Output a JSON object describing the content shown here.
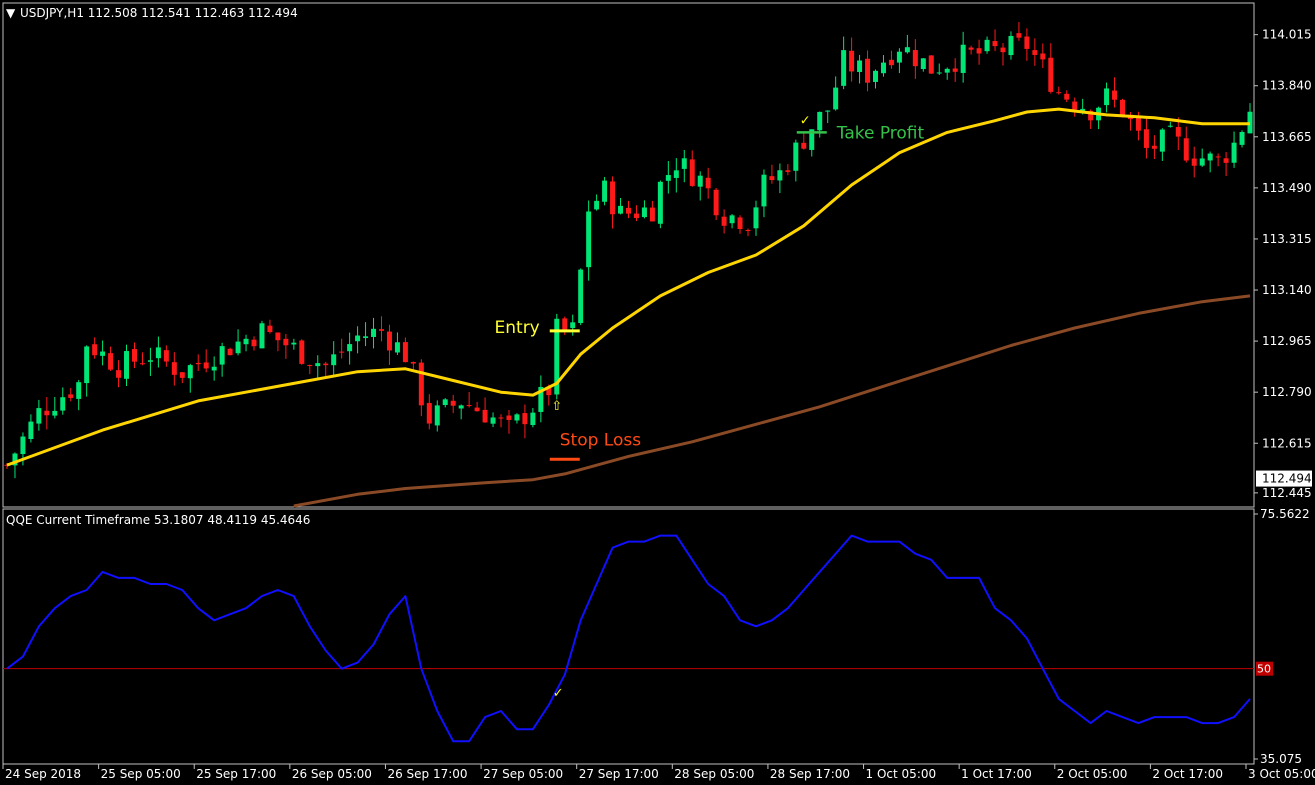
{
  "header": {
    "symbol_line": "USDJPY,H1  112.508 112.541 112.463 112.494",
    "indicator_line": "QQE Current Timeframe 53.1807 48.4119 45.4646"
  },
  "colors": {
    "background": "#000000",
    "frame": "#c0c0c0",
    "bull_candle": "#00e676",
    "bear_candle": "#ff1a1a",
    "ma_fast": "#ffd500",
    "ma_slow": "#8b4a26",
    "qqe_line": "#1010ff",
    "level_line": "#c00000",
    "entry": "#ffff33",
    "stop_loss": "#ff4a14",
    "take_profit": "#36c24a",
    "check": "#ffff00"
  },
  "chart_data": [
    {
      "type": "candlestick",
      "symbol": "USDJPY",
      "timeframe": "H1",
      "ylim": [
        112.4,
        114.12
      ],
      "y_ticks": [
        "114.015",
        "113.840",
        "113.665",
        "113.490",
        "113.315",
        "113.140",
        "112.965",
        "112.790",
        "112.615",
        "112.445"
      ],
      "y_tick_values": [
        114.015,
        113.84,
        113.665,
        113.49,
        113.315,
        113.14,
        112.965,
        112.79,
        112.615,
        112.445
      ],
      "current_price": "112.494",
      "current_price_value": 112.494,
      "ohlc_header": {
        "open": 112.508,
        "high": 112.541,
        "low": 112.463,
        "close": 112.494
      },
      "x_ticks": [
        "24 Sep 2018",
        "25 Sep 05:00",
        "25 Sep 17:00",
        "26 Sep 05:00",
        "26 Sep 17:00",
        "27 Sep 05:00",
        "27 Sep 17:00",
        "28 Sep 05:00",
        "28 Sep 17:00",
        "1 Oct 05:00",
        "1 Oct 17:00",
        "2 Oct 05:00",
        "2 Oct 17:00",
        "3 Oct 05:00"
      ],
      "x_tick_index": [
        0,
        12,
        24,
        36,
        48,
        60,
        72,
        84,
        96,
        108,
        120,
        132,
        144,
        156
      ],
      "bar_count": 157,
      "close_path": [
        [
          0,
          112.54
        ],
        [
          4,
          112.72
        ],
        [
          9,
          112.82
        ],
        [
          10,
          112.96
        ],
        [
          14,
          112.88
        ],
        [
          18,
          112.92
        ],
        [
          22,
          112.86
        ],
        [
          26,
          112.92
        ],
        [
          32,
          113.0
        ],
        [
          36,
          112.94
        ],
        [
          40,
          112.88
        ],
        [
          44,
          112.98
        ],
        [
          47,
          113.0
        ],
        [
          50,
          112.92
        ],
        [
          53,
          112.7
        ],
        [
          57,
          112.76
        ],
        [
          60,
          112.72
        ],
        [
          63,
          112.66
        ],
        [
          66,
          112.74
        ],
        [
          68,
          112.8
        ],
        [
          69,
          113.0
        ],
        [
          71,
          113.0
        ],
        [
          72,
          113.2
        ],
        [
          73,
          113.42
        ],
        [
          75,
          113.48
        ],
        [
          77,
          113.4
        ],
        [
          81,
          113.42
        ],
        [
          82,
          113.5
        ],
        [
          84,
          113.58
        ],
        [
          87,
          113.52
        ],
        [
          90,
          113.4
        ],
        [
          93,
          113.38
        ],
        [
          95,
          113.5
        ],
        [
          97,
          113.54
        ],
        [
          99,
          113.62
        ],
        [
          101,
          113.7
        ],
        [
          103,
          113.76
        ],
        [
          105,
          113.92
        ],
        [
          108,
          113.88
        ],
        [
          112,
          113.98
        ],
        [
          116,
          113.9
        ],
        [
          120,
          113.94
        ],
        [
          124,
          113.96
        ],
        [
          128,
          113.98
        ],
        [
          132,
          113.82
        ],
        [
          136,
          113.76
        ],
        [
          138,
          113.8
        ],
        [
          140,
          113.76
        ],
        [
          143,
          113.62
        ],
        [
          146,
          113.66
        ],
        [
          149,
          113.6
        ],
        [
          152,
          113.58
        ],
        [
          154,
          113.64
        ],
        [
          156,
          113.76
        ]
      ],
      "ma_fast": [
        [
          0,
          112.54
        ],
        [
          12,
          112.66
        ],
        [
          24,
          112.76
        ],
        [
          36,
          112.82
        ],
        [
          44,
          112.86
        ],
        [
          50,
          112.87
        ],
        [
          56,
          112.83
        ],
        [
          62,
          112.79
        ],
        [
          66,
          112.78
        ],
        [
          69,
          112.82
        ],
        [
          72,
          112.92
        ],
        [
          76,
          113.01
        ],
        [
          82,
          113.12
        ],
        [
          88,
          113.2
        ],
        [
          94,
          113.26
        ],
        [
          100,
          113.36
        ],
        [
          106,
          113.5
        ],
        [
          112,
          113.61
        ],
        [
          118,
          113.68
        ],
        [
          124,
          113.72
        ],
        [
          128,
          113.75
        ],
        [
          132,
          113.76
        ],
        [
          138,
          113.74
        ],
        [
          144,
          113.73
        ],
        [
          150,
          113.71
        ],
        [
          156,
          113.71
        ]
      ],
      "ma_slow": [
        [
          36,
          112.4
        ],
        [
          44,
          112.44
        ],
        [
          50,
          112.46
        ],
        [
          60,
          112.48
        ],
        [
          66,
          112.49
        ],
        [
          70,
          112.51
        ],
        [
          78,
          112.57
        ],
        [
          86,
          112.62
        ],
        [
          94,
          112.68
        ],
        [
          102,
          112.74
        ],
        [
          110,
          112.81
        ],
        [
          118,
          112.88
        ],
        [
          126,
          112.95
        ],
        [
          134,
          113.01
        ],
        [
          142,
          113.06
        ],
        [
          150,
          113.1
        ],
        [
          156,
          113.12
        ]
      ],
      "annotations": [
        {
          "label": "Entry",
          "price": 113.0,
          "bar": 70
        },
        {
          "label": "Stop Loss",
          "price": 112.56,
          "bar": 70
        },
        {
          "label": "Take Profit",
          "price": 113.68,
          "bar": 101
        }
      ],
      "signal_arrow": {
        "bar": 69,
        "price": 112.75
      }
    },
    {
      "type": "line",
      "name": "QQE Current Timeframe",
      "values_header": [
        53.1807,
        48.4119,
        45.4646
      ],
      "ylim": [
        35.075,
        75.5622
      ],
      "y_ticks": [
        "75.5622",
        "35.075"
      ],
      "y_tick_values": [
        75.5622,
        35.075
      ],
      "level": 50,
      "level_label": "50",
      "series": [
        {
          "values": [
            [
              0,
              50
            ],
            [
              2,
              52
            ],
            [
              4,
              57
            ],
            [
              6,
              60
            ],
            [
              8,
              62
            ],
            [
              10,
              63
            ],
            [
              12,
              66
            ],
            [
              14,
              65
            ],
            [
              16,
              65
            ],
            [
              18,
              64
            ],
            [
              20,
              64
            ],
            [
              22,
              63
            ],
            [
              24,
              60
            ],
            [
              26,
              58
            ],
            [
              28,
              59
            ],
            [
              30,
              60
            ],
            [
              32,
              62
            ],
            [
              34,
              63
            ],
            [
              36,
              62
            ],
            [
              38,
              57
            ],
            [
              40,
              53
            ],
            [
              42,
              50
            ],
            [
              44,
              51
            ],
            [
              46,
              54
            ],
            [
              48,
              59
            ],
            [
              50,
              62
            ],
            [
              52,
              50
            ],
            [
              54,
              43
            ],
            [
              56,
              38
            ],
            [
              58,
              38
            ],
            [
              60,
              42
            ],
            [
              62,
              43
            ],
            [
              64,
              40
            ],
            [
              66,
              40
            ],
            [
              68,
              44
            ],
            [
              70,
              49
            ],
            [
              72,
              58
            ],
            [
              74,
              64
            ],
            [
              76,
              70
            ],
            [
              78,
              71
            ],
            [
              80,
              71
            ],
            [
              82,
              72
            ],
            [
              84,
              72
            ],
            [
              86,
              68
            ],
            [
              88,
              64
            ],
            [
              90,
              62
            ],
            [
              92,
              58
            ],
            [
              94,
              57
            ],
            [
              96,
              58
            ],
            [
              98,
              60
            ],
            [
              100,
              63
            ],
            [
              102,
              66
            ],
            [
              104,
              69
            ],
            [
              106,
              72
            ],
            [
              108,
              71
            ],
            [
              110,
              71
            ],
            [
              112,
              71
            ],
            [
              114,
              69
            ],
            [
              116,
              68
            ],
            [
              118,
              65
            ],
            [
              120,
              65
            ],
            [
              122,
              65
            ],
            [
              124,
              60
            ],
            [
              126,
              58
            ],
            [
              128,
              55
            ],
            [
              130,
              50
            ],
            [
              132,
              45
            ],
            [
              134,
              43
            ],
            [
              136,
              41
            ],
            [
              138,
              43
            ],
            [
              140,
              42
            ],
            [
              142,
              41
            ],
            [
              144,
              42
            ],
            [
              146,
              42
            ],
            [
              148,
              42
            ],
            [
              150,
              41
            ],
            [
              152,
              41
            ],
            [
              154,
              42
            ],
            [
              156,
              45
            ]
          ]
        }
      ]
    }
  ]
}
